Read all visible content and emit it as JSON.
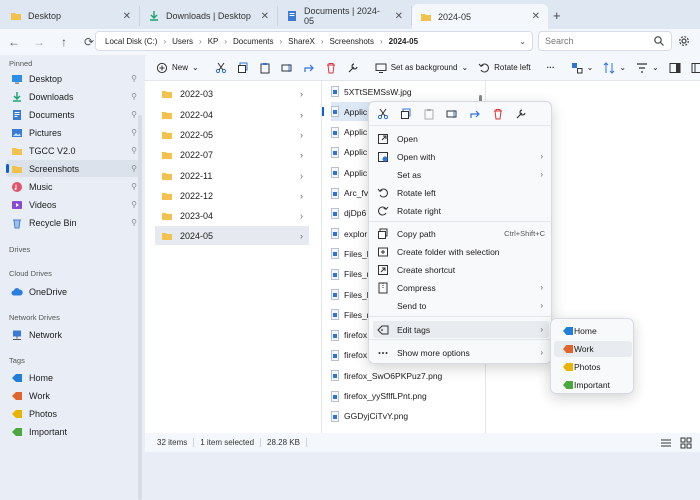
{
  "tabs": [
    {
      "label": "Desktop",
      "icon": "folder-icon"
    },
    {
      "label": "Downloads | Desktop",
      "icon": "download-icon"
    },
    {
      "label": "Documents | 2024-05",
      "icon": "documents-icon"
    },
    {
      "label": "2024-05",
      "icon": "folder-icon"
    }
  ],
  "breadcrumbs": [
    "Local Disk (C:)",
    "Users",
    "KP",
    "Documents",
    "ShareX",
    "Screenshots",
    "2024-05"
  ],
  "search": {
    "placeholder": "Search"
  },
  "toolbar": {
    "new_label": "New",
    "background_label": "Set as background",
    "rotate_label": "Rotate left",
    "more_label": "···"
  },
  "sidebar": {
    "pinned_header": "Pinned",
    "pinned": [
      {
        "label": "Desktop",
        "icon": "desktop-icon",
        "color": "#2d8ee6"
      },
      {
        "label": "Downloads",
        "icon": "download-icon",
        "color": "#1aa56b"
      },
      {
        "label": "Documents",
        "icon": "documents-icon",
        "color": "#3a7bd5"
      },
      {
        "label": "Pictures",
        "icon": "pictures-icon",
        "color": "#3a7bd5"
      },
      {
        "label": "TGCC V2.0",
        "icon": "folder-icon",
        "color": "#f2c14e"
      },
      {
        "label": "Screenshots",
        "icon": "folder-icon",
        "color": "#f2c14e"
      },
      {
        "label": "Music",
        "icon": "music-icon",
        "color": "#e2536b"
      },
      {
        "label": "Videos",
        "icon": "videos-icon",
        "color": "#8a4bd6"
      },
      {
        "label": "Recycle Bin",
        "icon": "recycle-bin-icon",
        "color": "#4a7fd0"
      }
    ],
    "drives_header": "Drives",
    "cloud_header": "Cloud Drives",
    "onedrive": "OneDrive",
    "network_header": "Network Drives",
    "network": "Network",
    "tags_header": "Tags",
    "tags": [
      {
        "label": "Home",
        "color": "#1f7fd8"
      },
      {
        "label": "Work",
        "color": "#e0642b"
      },
      {
        "label": "Photos",
        "color": "#e9b400"
      },
      {
        "label": "Important",
        "color": "#4aa83c"
      }
    ]
  },
  "folders": [
    "2022-03",
    "2022-04",
    "2022-05",
    "2022-07",
    "2022-11",
    "2022-12",
    "2023-04",
    "2024-05"
  ],
  "files": [
    "5XTtSEMSsW.jpg",
    "Applic",
    "Applic",
    "Applic",
    "Applic",
    "Arc_fv",
    "djDp6",
    "explor",
    "Files_F",
    "Files_r",
    "Files_F",
    "Files_n",
    "firefox",
    "firefox",
    "firefox_SwO6PKPuz7.png",
    "firefox_yySflfLPnt.png",
    "GGDyjCiTvY.png"
  ],
  "status": {
    "items": "32 items",
    "selected": "1 item selected",
    "size": "28.28 KB"
  },
  "context_menu": {
    "items": [
      {
        "label": "Open",
        "icon": "open-icon"
      },
      {
        "label": "Open with",
        "icon": "open-with-icon",
        "submenu": true
      },
      {
        "label": "Set as",
        "icon": "",
        "submenu": true
      },
      {
        "label": "Rotate left",
        "icon": "rotate-left-icon"
      },
      {
        "label": "Rotate right",
        "icon": "rotate-right-icon"
      },
      {
        "label": "Copy path",
        "icon": "copy-path-icon",
        "shortcut": "Ctrl+Shift+C"
      },
      {
        "label": "Create folder with selection",
        "icon": "create-folder-icon"
      },
      {
        "label": "Create shortcut",
        "icon": "create-shortcut-icon"
      },
      {
        "label": "Compress",
        "icon": "compress-icon",
        "submenu": true
      },
      {
        "label": "Send to",
        "icon": "",
        "submenu": true
      },
      {
        "label": "Edit tags",
        "icon": "tag-icon",
        "submenu": true
      },
      {
        "label": "Show more options",
        "icon": "more-icon",
        "submenu": true
      }
    ]
  },
  "tags_submenu": [
    {
      "label": "Home",
      "color": "#1f7fd8"
    },
    {
      "label": "Work",
      "color": "#e0642b"
    },
    {
      "label": "Photos",
      "color": "#e9b400"
    },
    {
      "label": "Important",
      "color": "#4aa83c"
    }
  ]
}
